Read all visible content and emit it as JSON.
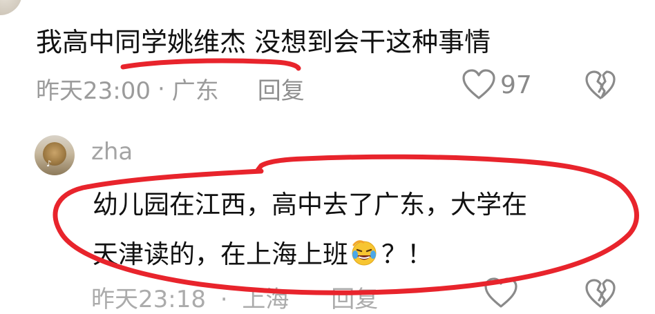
{
  "comment1": {
    "username": "",
    "text": "我高中同学姚维杰 没想到会干这种事情",
    "time": "昨天23:00",
    "separator": "·",
    "location": "广东",
    "reply_label": "回复",
    "like_count": "97"
  },
  "comment2": {
    "username": "zha",
    "avatar_mark": "♪",
    "line1": "幼儿园在江西，高中去了广东，大学在",
    "line2_before": "天津读的，在上海上班",
    "line2_after": "？！",
    "emoji": "rolling-laughing-face",
    "time": "昨天23:18",
    "separator": "·",
    "location": "上海",
    "reply_label": "回复"
  },
  "colors": {
    "annotation_red": "#e8242c",
    "text_primary": "#111111",
    "text_secondary": "#9b9b9b"
  }
}
